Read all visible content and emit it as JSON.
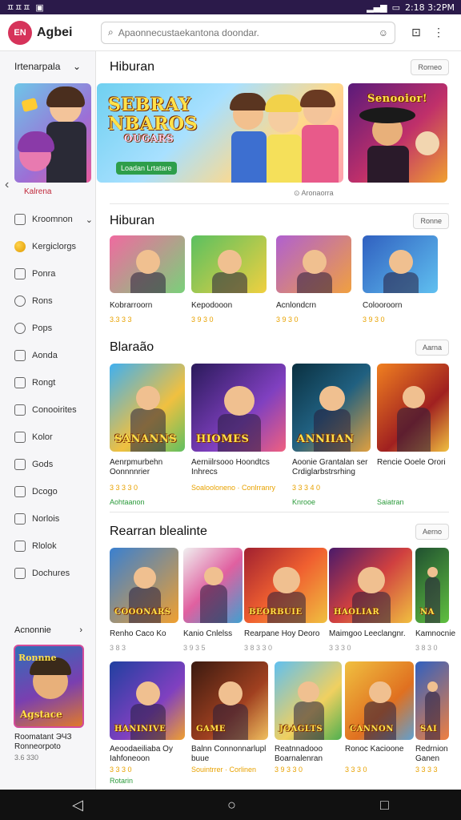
{
  "status": {
    "left": "ㅍㅍㅍ",
    "right": "2:18 3:2PM"
  },
  "app": {
    "logo": "EN",
    "name": "Agbei"
  },
  "search": {
    "placeholder": "Apaonnecustaekantona doondar."
  },
  "sidebar": {
    "header": "Irtenarpala",
    "feature_caption": "Kalrena",
    "items": [
      {
        "label": "Kroomnon",
        "icon": "user-icon"
      },
      {
        "label": "Kergiclorgs",
        "icon": "ball-icon"
      },
      {
        "label": "Ponra",
        "icon": "grid-icon"
      },
      {
        "label": "Rons",
        "icon": "chat-icon"
      },
      {
        "label": "Pops",
        "icon": "person-icon"
      },
      {
        "label": "Aonda",
        "icon": "doc-icon"
      },
      {
        "label": "Rongt",
        "icon": "list-icon"
      },
      {
        "label": "Conooirites",
        "icon": "gear-icon"
      },
      {
        "label": "Kolor",
        "icon": "bookmark-icon"
      },
      {
        "label": "Gods",
        "icon": "calendar-icon"
      },
      {
        "label": "Dcogo",
        "icon": "tag-icon"
      },
      {
        "label": "Norlois",
        "icon": "flag-icon"
      },
      {
        "label": "Rlolok",
        "icon": "box-icon"
      },
      {
        "label": "Dochures",
        "icon": "file-icon"
      }
    ],
    "recommend_header": "Acnonnie",
    "recommend_card": {
      "title": "Roomatant ЭЧЗ Ronneorpoto",
      "meta": "3.6 330"
    }
  },
  "sections": [
    {
      "title": "Hiburan",
      "more": "Rorneo",
      "banner_main": {
        "line1": "SEBRAY",
        "line2": "NBAROS",
        "line3": "OUGARS",
        "button": "Loadan Lrtatare"
      },
      "banner_side": {
        "text": "Senooior!"
      },
      "caption": "Aronaorra"
    },
    {
      "title": "Hiburan",
      "more": "Ronne",
      "cards": [
        {
          "title": "Kobrarroorn",
          "meta": "3.3 3 3"
        },
        {
          "title": "Kepodooon",
          "meta": "3 9 3 0"
        },
        {
          "title": "Acnlondcrn",
          "meta": "3 9 3 0"
        },
        {
          "title": "Colooroorn",
          "meta": "3 9 3 0"
        }
      ]
    },
    {
      "title": "Blaraão",
      "more": "Aarna",
      "cards": [
        {
          "title": "Aenrpmurbehn Oonnnnrier",
          "meta": "3 3 3 3 0",
          "tag": "Aohtaanon",
          "art": "SANANNS"
        },
        {
          "title": "Aerniilrsooo Hoondtcs Inhrecs",
          "meta": "Soalooloneno · Conlrranry",
          "art": "HIOMES"
        },
        {
          "title": "Aoonie Grantalan ser Crdiglarbstrsrhing",
          "meta": "3 3 3 4 0",
          "tag": "Knrooe",
          "art": "ANNIIAN"
        },
        {
          "title": "Rencie Ooele Orori",
          "meta": "",
          "tag": "Saiatran",
          "art": ""
        }
      ]
    },
    {
      "title": "Rearran blealinte",
      "more": "Aerno",
      "cards_row1": [
        {
          "title": "Renho Caco Ko",
          "meta": "3 8 3",
          "art": "COOONARS"
        },
        {
          "title": "Kanio Cnlelss",
          "meta": "3 9 3 5",
          "art": ""
        },
        {
          "title": "Rearpane Hoy Deoro",
          "meta": "3 8 3 3 0",
          "art": "BEORBUIE"
        },
        {
          "title": "Maimgoo Leeclangnr.",
          "meta": "3 3 3 0",
          "art": "HAOLIAR"
        },
        {
          "title": "Kamnocnie",
          "meta": "3 8 3 0",
          "art": "NA"
        }
      ],
      "cards_row2": [
        {
          "title": "Aeoodaeiliaba Oy Iahfoneoon",
          "meta": "3 3 3 0",
          "tag": "Rotarin",
          "art": "HANINIVE"
        },
        {
          "title": "Balnn Connonnarlupl buue",
          "meta": "Souintrrer · Corlinen",
          "art": "GAME"
        },
        {
          "title": "Reatnnadooo Boarnalenran",
          "meta": "3 9 3 3 0",
          "art": "JOAGLTS"
        },
        {
          "title": "Ronoc Kacioone",
          "meta": "3 3 3 0",
          "art": "CANNON"
        },
        {
          "title": "Redrnion Ganen",
          "meta": "3 3 3 3",
          "art": "SAI"
        }
      ]
    }
  ],
  "colors": {
    "accent": "#d6335a",
    "star": "#e8a200",
    "tag": "#2a9a3a",
    "statusbar": "#2b1a4a"
  }
}
